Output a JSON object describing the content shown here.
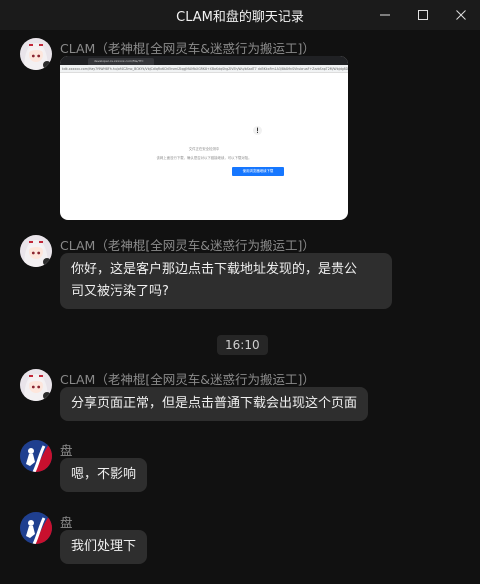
{
  "window": {
    "title": "CLAM和盘的聊天记录"
  },
  "messages": [
    {
      "sender": "CLAM（老神棍[全网灵车&迷惑行为搬运工]）",
      "type": "image",
      "image": {
        "tab_title": "developer.cs.xxxxxx.com/file/?f=",
        "address": "kdk.xxxxxx.com/Hay7f9WH8Fh.hu/of4CZmo_BOXYk/VbjCdIqRx6ChEhvmIZIqgJMAMbXGRK8+XBaKdqShgZiVEh/Wu/bSadT7 dd5KkxFm1A3/8tAMnSVhubruaF+ZzzbSnpT2M/Wbjdg8Dk",
        "warn_title": "文件正在安全检测中",
        "warn_desc": "该网上面没行下载，确认是否对以下链接继续，可以下载对阻。",
        "button_label": "使用浏览器继续下载"
      }
    },
    {
      "sender": "CLAM（老神棍[全网灵车&迷惑行为搬运工]）",
      "type": "text",
      "lines": [
        "你好，这是客户那边点击下载地址发现的，是贵公",
        "司又被污染了吗?"
      ]
    },
    {
      "type": "time",
      "text": "16:10"
    },
    {
      "sender": "CLAM（老神棍[全网灵车&迷惑行为搬运工]）",
      "type": "text",
      "lines": [
        "分享页面正常，但是点击普通下载会出现这个页面"
      ]
    },
    {
      "sender": "盘",
      "type": "text",
      "lines": [
        "嗯，不影响"
      ]
    },
    {
      "sender": "盘",
      "type": "text",
      "lines": [
        "我们处理下"
      ]
    }
  ],
  "colors": {
    "background": "#111111",
    "bubble": "#2e2e2e",
    "sender_text": "#8a8a8a",
    "accent_button": "#1677ff"
  },
  "icons": {
    "minimize": "minimize-icon",
    "maximize": "maximize-icon",
    "close": "close-icon",
    "warning": "warning-icon"
  }
}
